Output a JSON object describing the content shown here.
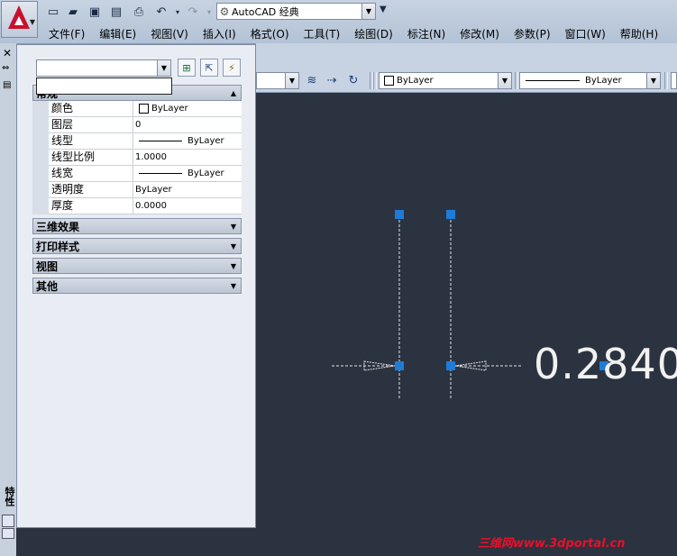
{
  "app": {
    "workspace": "AutoCAD 经典"
  },
  "menu": [
    "文件(F)",
    "编辑(E)",
    "视图(V)",
    "插入(I)",
    "格式(O)",
    "工具(T)",
    "绘图(D)",
    "标注(N)",
    "修改(M)",
    "参数(P)",
    "窗口(W)",
    "帮助(H)"
  ],
  "toolbar": {
    "color": "ByLayer",
    "linetype": "ByLayer"
  },
  "properties": {
    "title": "特性",
    "section_general": "常规",
    "rows": [
      {
        "name": "颜色",
        "value": "ByLayer"
      },
      {
        "name": "图层",
        "value": "0"
      },
      {
        "name": "线型",
        "value": "ByLayer"
      },
      {
        "name": "线型比例",
        "value": "1.0000"
      },
      {
        "name": "线宽",
        "value": "ByLayer"
      },
      {
        "name": "透明度",
        "value": "ByLayer"
      },
      {
        "name": "厚度",
        "value": "0.0000"
      }
    ],
    "sections": [
      "三维效果",
      "打印样式",
      "视图",
      "其他"
    ]
  },
  "drawing": {
    "dimension_text": "0.2840"
  },
  "watermark": "三维网www.3dportal.cn"
}
